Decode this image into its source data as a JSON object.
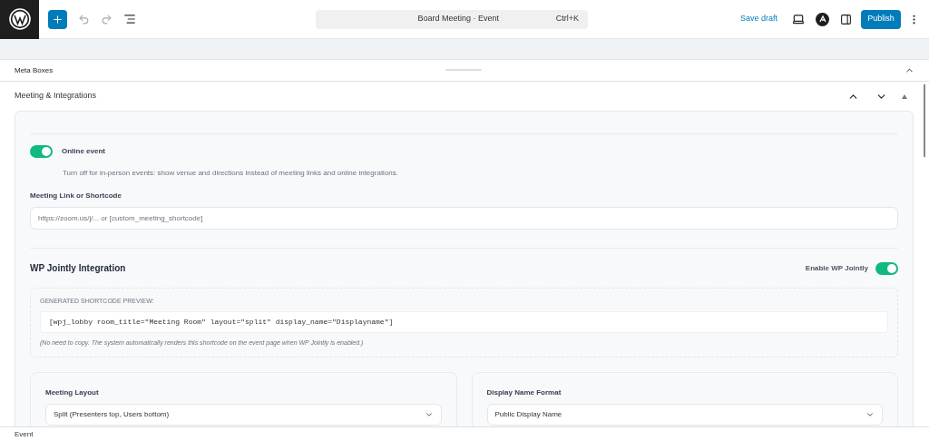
{
  "header": {
    "command_title": "Board Meeting · Event",
    "shortcut": "Ctrl+K",
    "save_draft": "Save draft",
    "publish": "Publish"
  },
  "meta_boxes": {
    "title": "Meta Boxes",
    "expanded": true
  },
  "section": {
    "title": "Meeting & Integrations",
    "expanded": true
  },
  "online_event": {
    "label": "Online event",
    "on": true,
    "help": "Turn off for in-person events: show venue and directions instead of meeting links and online integrations."
  },
  "meeting_link": {
    "label": "Meeting Link or Shortcode",
    "placeholder": "https://zoom.us/j/... or [custom_meeting_shortcode]"
  },
  "integration": {
    "title": "WP Jointly Integration",
    "toggle_label": "Enable WP Jointly",
    "on": true,
    "preview_label": "GENERATED SHORTCODE PREVIEW:",
    "shortcode": "[wpj_lobby room_title=\"Meeting Room\" layout=\"split\" display_name=\"Displayname\"]",
    "note": "(No need to copy. The system automatically renders this shortcode on the event page when WP Jointly is enabled.)"
  },
  "selects": [
    {
      "label": "Meeting Layout",
      "value": "Split (Presenters top, Users bottom)"
    },
    {
      "label": "Display Name Format",
      "value": "Public Display Name"
    }
  ],
  "footer": {
    "breadcrumb": "Event"
  }
}
